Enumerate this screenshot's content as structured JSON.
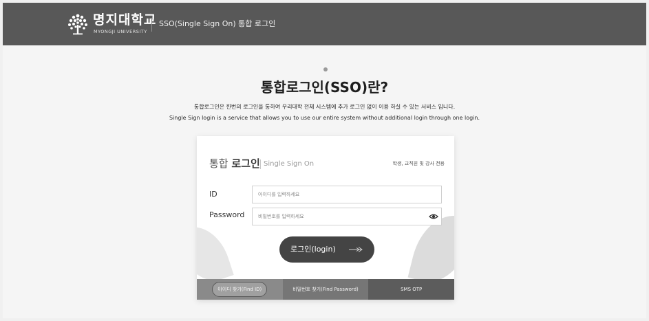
{
  "header": {
    "brand_ko": "명지대학교",
    "brand_en": "MYONGJI UNIVERSITY",
    "title": "SSO(Single Sign On) 통합 로그인",
    "logo_icon": "tree-logo-icon"
  },
  "intro": {
    "title": "통합로그인(SSO)란?",
    "desc_ko": "통합로그인은 한번의 로그인을 통하여 우리대학 전체 시스템에 추가 로그인 없이 이용 하실 수 있는 서비스 입니다.",
    "desc_en": "Single Sign login is a service that allows you to use our entire system without additional login through one login."
  },
  "login": {
    "title_light": "통합",
    "title_bold": "로그인",
    "subtitle": "Single Sign On",
    "note": "학생, 교직원 및 강사 전용",
    "id_label": "ID",
    "id_placeholder": "아이디를 입력하세요",
    "password_label": "Password",
    "password_placeholder": "비밀번호를 입력하세요",
    "eye_icon": "eye-icon",
    "button_label": "로그인(login)",
    "button_icon": "arrow-right-icon"
  },
  "tabs": [
    {
      "label": "아이디 찾기(Find ID)"
    },
    {
      "label": "비밀번호 찾기(Find Password)"
    },
    {
      "label": "SMS OTP"
    }
  ],
  "colors": {
    "header_bg": "#585858",
    "page_bg": "#f5f5f5",
    "button_bg": "#444444",
    "tab_1": "#8a8a8a",
    "tab_2": "#767676",
    "tab_3": "#5c5c5c"
  }
}
